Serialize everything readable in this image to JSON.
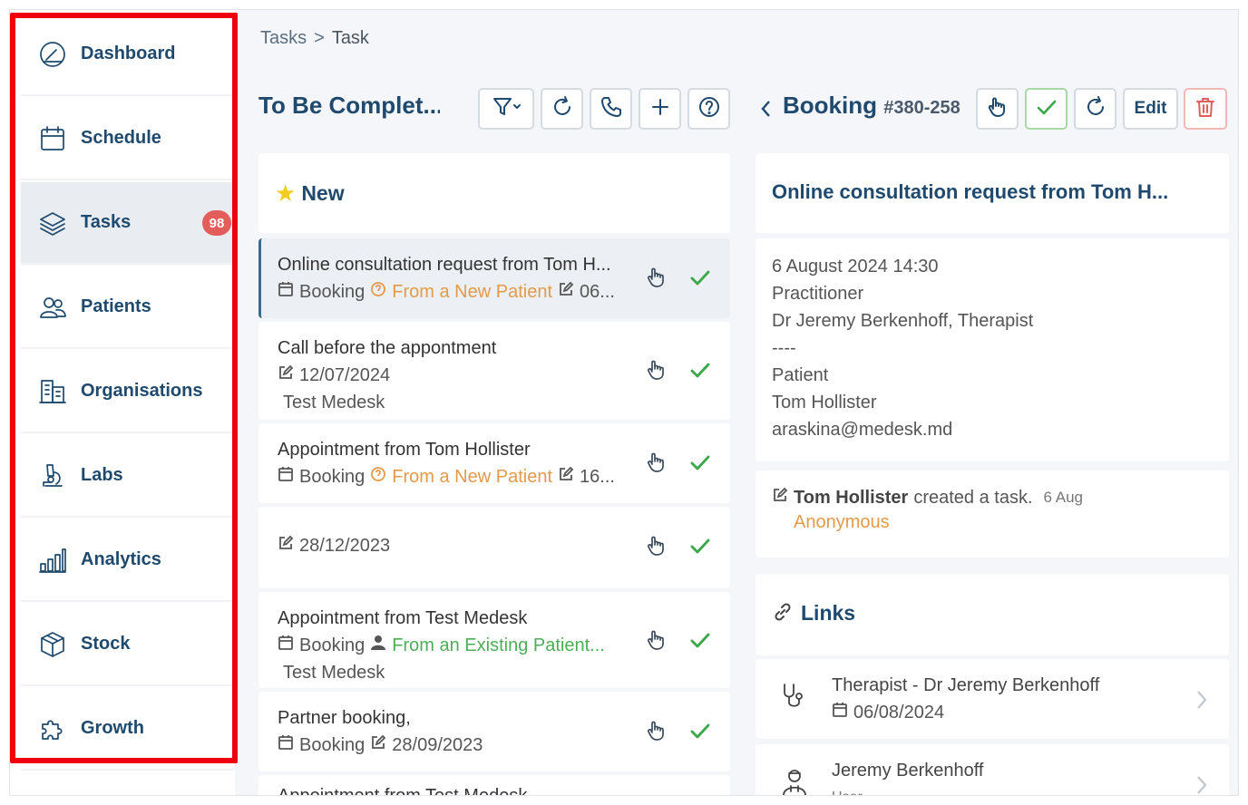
{
  "sidebar": {
    "items": [
      {
        "label": "Dashboard",
        "icon": "gauge-icon"
      },
      {
        "label": "Schedule",
        "icon": "calendar-icon"
      },
      {
        "label": "Tasks",
        "icon": "layers-icon",
        "badge": "98"
      },
      {
        "label": "Patients",
        "icon": "users-icon"
      },
      {
        "label": "Organisations",
        "icon": "building-icon"
      },
      {
        "label": "Labs",
        "icon": "microscope-icon"
      },
      {
        "label": "Analytics",
        "icon": "bar-chart-icon"
      },
      {
        "label": "Stock",
        "icon": "box-icon"
      },
      {
        "label": "Growth",
        "icon": "puzzle-icon"
      }
    ],
    "active_index": 2,
    "highlight_color": "#f0000f"
  },
  "breadcrumb": {
    "parent": "Tasks",
    "separator": ">",
    "current": "Task"
  },
  "list_panel": {
    "title": "To Be Complet...",
    "toolbar": [
      "filter-icon",
      "refresh-icon",
      "phone-icon",
      "plus-icon",
      "help-icon"
    ],
    "section": "New",
    "tasks": [
      {
        "title": "Online consultation request from Tom H...",
        "type": "Booking",
        "source": "From a New Patient",
        "date": "06..."
      },
      {
        "title": "Call before the appontment",
        "date": "12/07/2024",
        "person": "Test Medesk"
      },
      {
        "title": "Appointment from Tom Hollister",
        "type": "Booking",
        "source": "From a New Patient",
        "date": "16..."
      },
      {
        "date": "28/12/2023"
      },
      {
        "title": "Appointment from Test Medesk",
        "type": "Booking",
        "source": "From an Existing Patient...",
        "person": "Test Medesk"
      },
      {
        "title": "Partner booking,",
        "type": "Booking",
        "date": "28/09/2023"
      },
      {
        "title": "Appointment from Test Medesk"
      }
    ]
  },
  "detail_panel": {
    "title": "Booking",
    "number": "#380-258",
    "edit_label": "Edit",
    "task_title": "Online consultation request from Tom H...",
    "info_lines": [
      "6 August 2024 14:30",
      "Practitioner",
      "Dr Jeremy Berkenhoff, Therapist",
      "----",
      "Patient",
      "Tom Hollister",
      "araskina@medesk.md"
    ],
    "activity": {
      "author": "Tom Hollister",
      "action": "created a task.",
      "date": "6 Aug",
      "note": "Anonymous"
    },
    "links_title": "Links",
    "links": [
      {
        "title": "Therapist - Dr Jeremy Berkenhoff",
        "sub": "06/08/2024",
        "icon": "stethoscope-icon"
      },
      {
        "title": "Jeremy Berkenhoff",
        "sub": "User",
        "icon": "doctor-icon"
      }
    ]
  }
}
